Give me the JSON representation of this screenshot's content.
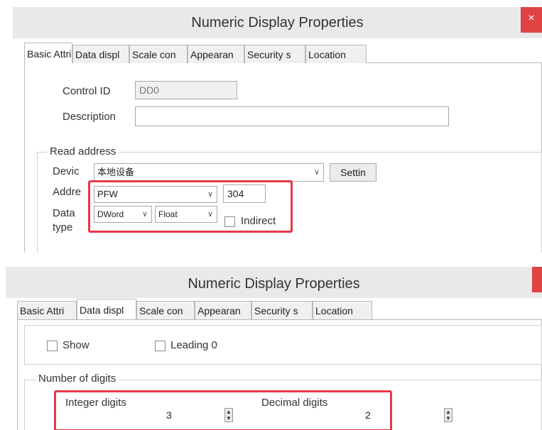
{
  "dialog1": {
    "title": "Numeric Display Properties",
    "close_glyph": "×",
    "tabs": [
      "Basic Attri",
      "Data displ",
      "Scale con",
      "Appearan",
      "Security s",
      "Location"
    ],
    "control_id_label": "Control ID",
    "control_id_value": "DD0",
    "description_label": "Description",
    "description_value": "",
    "read_address": {
      "group_title": "Read address",
      "device_label": "Devic",
      "device_value": "本地设备",
      "settings_button": "Settin",
      "address_label": "Addre",
      "address_type_value": "PFW",
      "address_number_value": "304",
      "data_type_label_1": "Data",
      "data_type_label_2": "type",
      "data_size_value": "DWord",
      "data_format_value": "Float",
      "indirect_label": "Indirect",
      "indirect_checked": false
    }
  },
  "dialog2": {
    "title": "Numeric Display Properties",
    "close_glyph": "×",
    "tabs": [
      "Basic Attri",
      "Data displ",
      "Scale con",
      "Appearan",
      "Security s",
      "Location"
    ],
    "show_label": "Show",
    "show_checked": false,
    "leading_zero_label": "Leading 0",
    "leading_zero_checked": false,
    "digits_group_title": "Number of digits",
    "integer_digits_label": "Integer digits",
    "integer_digits_value": "3",
    "decimal_digits_label": "Decimal digits",
    "decimal_digits_value": "2"
  },
  "colors": {
    "highlight": "#e63946",
    "close_button": "#e04343",
    "titlebar": "#e9e9e9"
  },
  "icons": {
    "dropdown": "chevron-down-icon",
    "spinner": "up-down-spinner-icon",
    "close": "close-icon"
  }
}
